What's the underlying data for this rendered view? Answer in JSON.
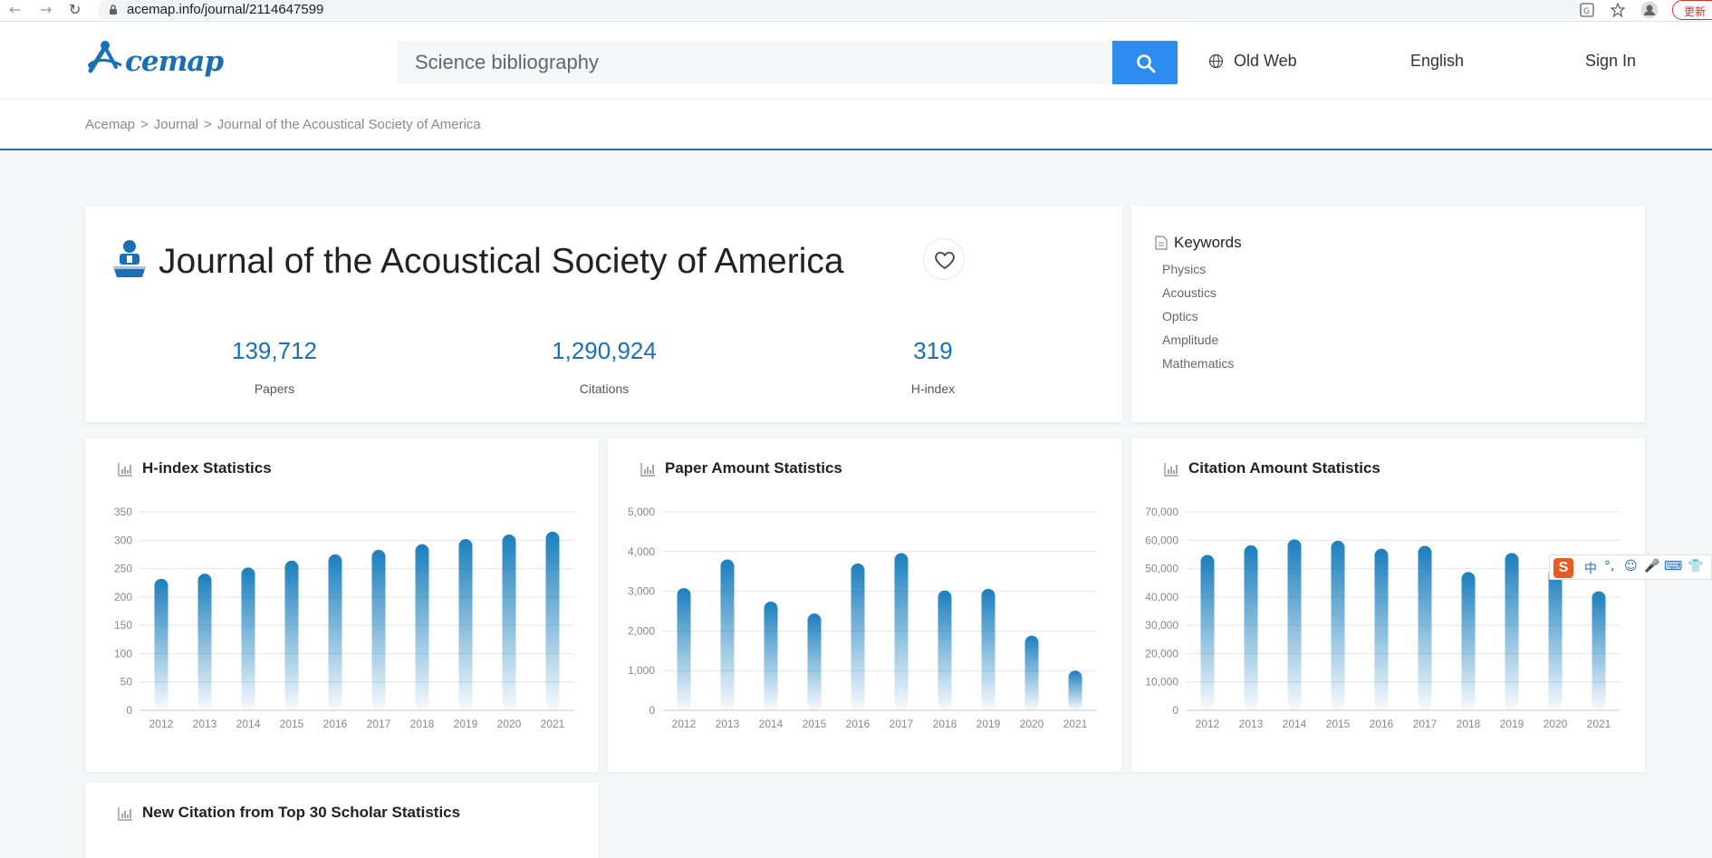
{
  "browser": {
    "url": "acemap.info/journal/2114647599",
    "update_label": "更新"
  },
  "header": {
    "logo_text": "cemap",
    "search_placeholder": "Science bibliography",
    "old_web": "Old Web",
    "language": "English",
    "sign_in": "Sign In"
  },
  "breadcrumb": [
    "Acemap",
    "Journal",
    "Journal of the Acoustical Society of America"
  ],
  "journal": {
    "title": "Journal of the Acoustical Society of America",
    "stats": [
      {
        "value": "139,712",
        "label": "Papers"
      },
      {
        "value": "1,290,924",
        "label": "Citations"
      },
      {
        "value": "319",
        "label": "H-index"
      }
    ]
  },
  "keywords": {
    "title": "Keywords",
    "items": [
      "Physics",
      "Acoustics",
      "Optics",
      "Amplitude",
      "Mathematics"
    ]
  },
  "ime": {
    "logo": "S",
    "items": [
      "中",
      "°,",
      "☺",
      "🎤",
      "⌨",
      "👕"
    ]
  },
  "chart_data": [
    {
      "type": "bar",
      "title": "H-index Statistics",
      "categories": [
        "2012",
        "2013",
        "2014",
        "2015",
        "2016",
        "2017",
        "2018",
        "2019",
        "2020",
        "2021"
      ],
      "values": [
        232,
        241,
        252,
        264,
        275,
        283,
        293,
        302,
        310,
        315
      ],
      "ylim": [
        0,
        350
      ],
      "yticks": [
        0,
        50,
        100,
        150,
        200,
        250,
        300,
        350
      ],
      "ytick_labels": [
        "0",
        "50",
        "100",
        "150",
        "200",
        "250",
        "300",
        "350"
      ],
      "color": "#1b7fbd",
      "grid": true
    },
    {
      "type": "bar",
      "title": "Paper Amount Statistics",
      "categories": [
        "2012",
        "2013",
        "2014",
        "2015",
        "2016",
        "2017",
        "2018",
        "2019",
        "2020",
        "2021"
      ],
      "values": [
        3080,
        3800,
        2740,
        2440,
        3700,
        3960,
        3020,
        3060,
        1880,
        1000
      ],
      "ylim": [
        0,
        5000
      ],
      "yticks": [
        0,
        1000,
        2000,
        3000,
        4000,
        5000
      ],
      "ytick_labels": [
        "0",
        "1,000",
        "2,000",
        "3,000",
        "4,000",
        "5,000"
      ],
      "color": "#1b7fbd",
      "grid": true
    },
    {
      "type": "bar",
      "title": "Citation Amount Statistics",
      "categories": [
        "2012",
        "2013",
        "2014",
        "2015",
        "2016",
        "2017",
        "2018",
        "2019",
        "2020",
        "2021"
      ],
      "values": [
        54800,
        58200,
        60300,
        59800,
        57000,
        58000,
        48800,
        55500,
        50600,
        42000
      ],
      "ylim": [
        0,
        70000
      ],
      "yticks": [
        0,
        10000,
        20000,
        30000,
        40000,
        50000,
        60000,
        70000
      ],
      "ytick_labels": [
        "0",
        "10,000",
        "20,000",
        "30,000",
        "40,000",
        "50,000",
        "60,000",
        "70,000"
      ],
      "color": "#1b7fbd",
      "grid": true
    },
    {
      "type": "bar",
      "title": "New Citation from Top 30 Scholar Statistics"
    }
  ]
}
